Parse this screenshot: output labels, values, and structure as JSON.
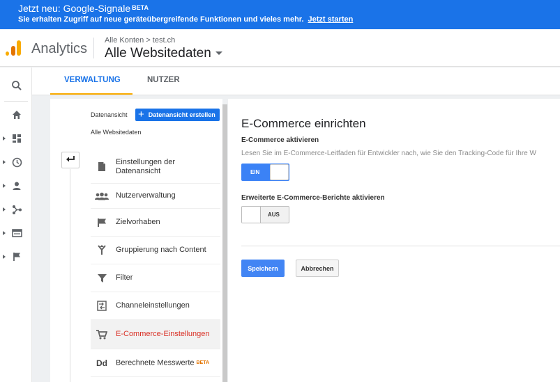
{
  "banner": {
    "title": "Jetzt neu: Google-Signale",
    "badge": "BETA",
    "text": "Sie erhalten Zugriff auf neue geräteübergreifende Funktionen und vieles mehr.",
    "link": "Jetzt starten"
  },
  "header": {
    "app_name": "Analytics",
    "breadcrumb": "Alle Konten > test.ch",
    "property": "Alle Websitedaten"
  },
  "rail": {
    "icons": [
      "search-icon",
      "home-icon",
      "dashboard-icon",
      "clock-icon",
      "person-icon",
      "acquisition-icon",
      "behavior-icon",
      "flag-icon"
    ]
  },
  "tabs": {
    "admin": "VERWALTUNG",
    "user": "NUTZER"
  },
  "admin_column": {
    "label": "Datenansicht",
    "create_button": "Datenansicht erstellen",
    "view_name": "Alle Websitedaten",
    "items": [
      {
        "label": "Einstellungen der Datenansicht",
        "icon": "document-icon"
      },
      {
        "label": "Nutzerverwaltung",
        "icon": "people-icon"
      },
      {
        "label": "Zielvorhaben",
        "icon": "flag-icon"
      },
      {
        "label": "Gruppierung nach Content",
        "icon": "merge-icon"
      },
      {
        "label": "Filter",
        "icon": "filter-icon"
      },
      {
        "label": "Channeleinstellungen",
        "icon": "channel-icon"
      },
      {
        "label": "E-Commerce-Einstellungen",
        "icon": "cart-icon"
      },
      {
        "label": "Berechnete Messwerte",
        "badge": "BETA",
        "icon": "dd-icon",
        "icon_text": "Dd"
      }
    ],
    "active_index": 6
  },
  "main": {
    "title": "E-Commerce einrichten",
    "ecommerce_label": "E-Commerce aktivieren",
    "description": "Lesen Sie im E-Commerce-Leitfaden für Entwickler nach, wie Sie den Tracking-Code für Ihre W",
    "toggle_on_label": "EIN",
    "enhanced_label": "Erweiterte E-Commerce-Berichte aktivieren",
    "toggle_off_label": "AUS",
    "save": "Speichern",
    "cancel": "Abbrechen"
  },
  "colors": {
    "accent": "#1a73e8",
    "active_menu_text": "#d93025",
    "tab_underline": "#f9ab00"
  }
}
